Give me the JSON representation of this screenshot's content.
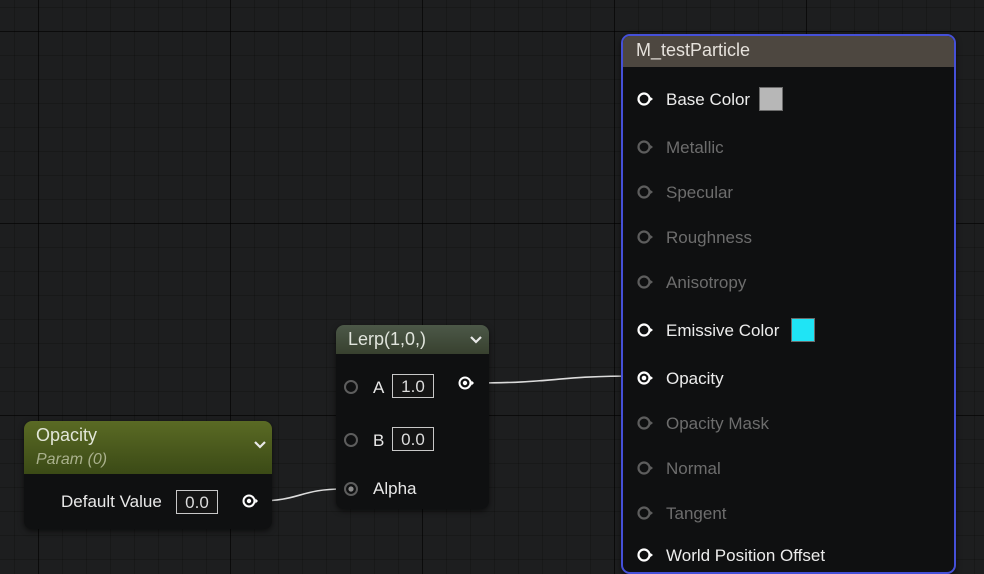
{
  "colors": {
    "pin_active": "#ffffff",
    "pin_inactive": "#5d5d5d",
    "label_active": "#ececec",
    "label_inactive": "#6d6d6d",
    "wire": "#dcdcdc",
    "base_color_swatch": "#b7b7b7",
    "emissive_color_swatch": "#1fe4f5",
    "selection_outline": "#4550d8"
  },
  "opacity_node": {
    "title": "Opacity",
    "subtitle": "Param (0)",
    "default_value_label": "Default Value",
    "default_value": "0.0",
    "collapse_icon": "chevron-down-icon"
  },
  "lerp_node": {
    "title": "Lerp(1,0,)",
    "collapse_icon": "chevron-down-icon",
    "a_label": "A",
    "a_value": "1.0",
    "b_label": "B",
    "b_value": "0.0",
    "alpha_label": "Alpha"
  },
  "material_node": {
    "title": "M_testParticle",
    "inputs": [
      {
        "label": "Base Color",
        "active": true,
        "swatch": "base_color"
      },
      {
        "label": "Metallic",
        "active": false
      },
      {
        "label": "Specular",
        "active": false
      },
      {
        "label": "Roughness",
        "active": false
      },
      {
        "label": "Anisotropy",
        "active": false
      },
      {
        "label": "Emissive Color",
        "active": true,
        "swatch": "emissive_color"
      },
      {
        "label": "Opacity",
        "active": true,
        "connected": true
      },
      {
        "label": "Opacity Mask",
        "active": false
      },
      {
        "label": "Normal",
        "active": false
      },
      {
        "label": "Tangent",
        "active": false
      },
      {
        "label": "World Position Offset",
        "active": true
      }
    ]
  }
}
